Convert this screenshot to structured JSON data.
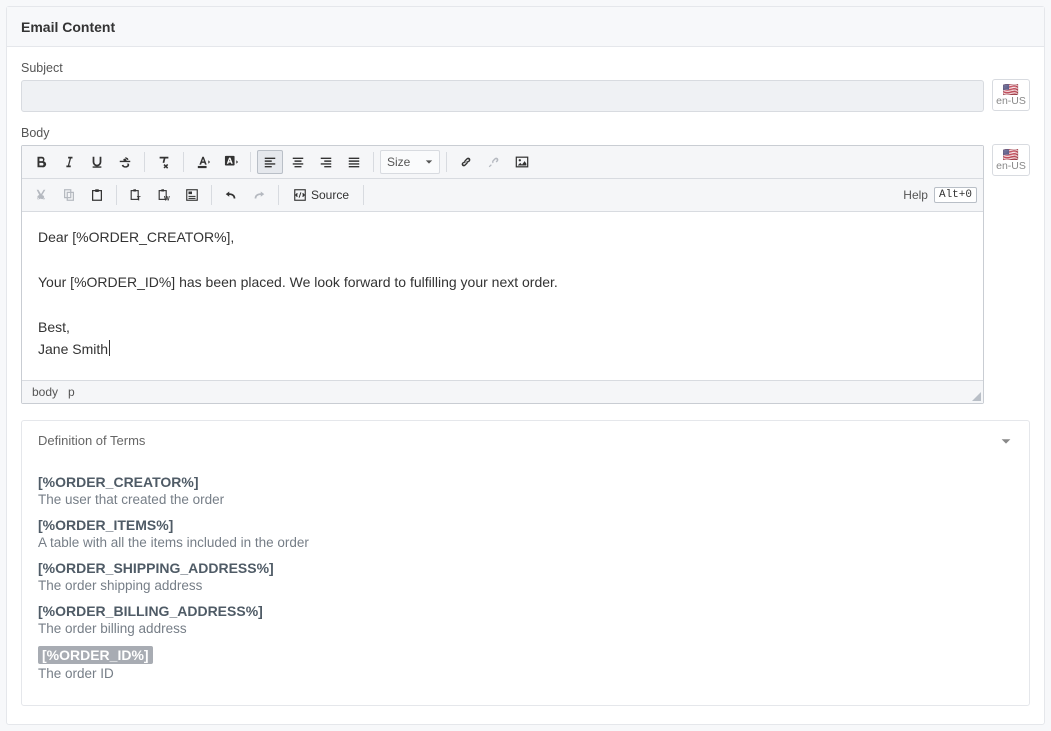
{
  "header": {
    "title": "Email Content"
  },
  "subject": {
    "label": "Subject",
    "value": ""
  },
  "body": {
    "label": "Body"
  },
  "lang": {
    "code": "en-US",
    "flag": "🇺🇸"
  },
  "toolbar": {
    "size_label": "Size",
    "source_label": "Source",
    "help_label": "Help",
    "help_key": "Alt+0"
  },
  "editor": {
    "line1": "Dear [%ORDER_CREATOR%],",
    "line2": "Your [%ORDER_ID%] has been placed. We look forward to fulfilling your next order.",
    "line3": "Best,",
    "line4": "Jane Smith"
  },
  "status": {
    "path1": "body",
    "path2": "p"
  },
  "terms": {
    "title": "Definition of Terms",
    "items": [
      {
        "token": "[%ORDER_CREATOR%]",
        "desc": "The user that created the order",
        "highlight": false
      },
      {
        "token": "[%ORDER_ITEMS%]",
        "desc": "A table with all the items included in the order",
        "highlight": false
      },
      {
        "token": "[%ORDER_SHIPPING_ADDRESS%]",
        "desc": "The order shipping address",
        "highlight": false
      },
      {
        "token": "[%ORDER_BILLING_ADDRESS%]",
        "desc": "The order billing address",
        "highlight": false
      },
      {
        "token": "[%ORDER_ID%]",
        "desc": "The order ID",
        "highlight": true
      }
    ]
  }
}
